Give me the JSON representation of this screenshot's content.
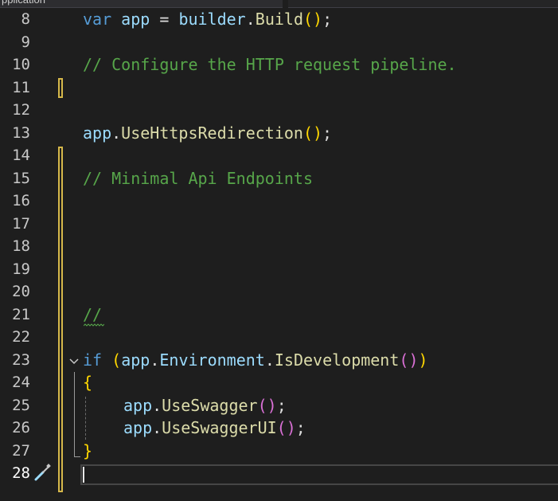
{
  "window": {
    "tab_title": "pplication"
  },
  "editor": {
    "current_line_number": "28",
    "lines": [
      {
        "num": "8",
        "text": "var app = builder.Build();"
      },
      {
        "num": "9",
        "text": ""
      },
      {
        "num": "10",
        "text": "// Configure the HTTP request pipeline."
      },
      {
        "num": "11",
        "text": ""
      },
      {
        "num": "12",
        "text": ""
      },
      {
        "num": "13",
        "text": "app.UseHttpsRedirection();"
      },
      {
        "num": "14",
        "text": ""
      },
      {
        "num": "15",
        "text": "// Minimal Api Endpoints"
      },
      {
        "num": "16",
        "text": ""
      },
      {
        "num": "17",
        "text": ""
      },
      {
        "num": "18",
        "text": ""
      },
      {
        "num": "19",
        "text": ""
      },
      {
        "num": "20",
        "text": ""
      },
      {
        "num": "21",
        "text": "//"
      },
      {
        "num": "22",
        "text": ""
      },
      {
        "num": "23",
        "text": "if (app.Environment.IsDevelopment())"
      },
      {
        "num": "24",
        "text": "{"
      },
      {
        "num": "25",
        "text": "app.UseSwagger();"
      },
      {
        "num": "26",
        "text": "app.UseSwaggerUI();"
      },
      {
        "num": "27",
        "text": "}"
      },
      {
        "num": "28",
        "text": ""
      }
    ],
    "tokens": {
      "l8": [
        "var",
        "app",
        "=",
        "builder",
        ".",
        "Build",
        "()",
        ";"
      ],
      "l10": "// Configure the HTTP request pipeline.",
      "l13": [
        "app",
        ".",
        "UseHttpsRedirection",
        "()",
        ";"
      ],
      "l15": "// Minimal Api Endpoints",
      "l21": "//",
      "l23": [
        "if",
        "(",
        "app",
        ".",
        "Environment",
        ".",
        "IsDevelopment",
        "()",
        ")"
      ],
      "l24": "{",
      "l25": [
        "app",
        ".",
        "UseSwagger",
        "()",
        ";"
      ],
      "l26": [
        "app",
        ".",
        "UseSwaggerUI",
        "()",
        ";"
      ],
      "l27": "}"
    }
  },
  "colors": {
    "background": "#1e1e1e",
    "keyword": "#569cd6",
    "variable": "#9cdcfe",
    "method": "#dcdcaa",
    "comment": "#57a64a",
    "bracket": "#ffd700",
    "change_bar": "#d6b84a"
  },
  "icons": {
    "fold": "chevron-down-icon",
    "quick_actions": "screwdriver-icon"
  }
}
